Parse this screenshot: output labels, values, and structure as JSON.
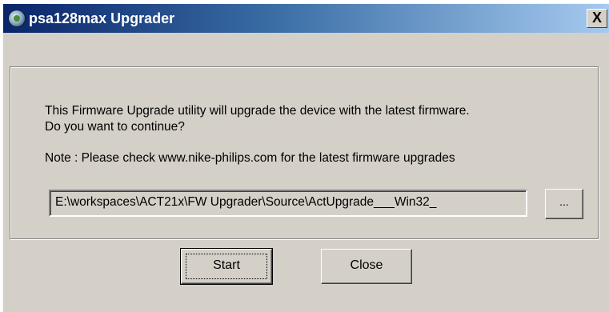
{
  "window": {
    "title": "psa128max Upgrader",
    "close_glyph": "X"
  },
  "dialog": {
    "message_line1": "This Firmware Upgrade utility will upgrade the device with the latest firmware.",
    "message_line2": "Do you want to continue?",
    "note": "Note : Please check www.nike-philips.com for the latest firmware upgrades",
    "path_value": "E:\\workspaces\\ACT21x\\FW Upgrader\\Source\\ActUpgrade___Win32_",
    "browse_label": "...",
    "start_label": "Start",
    "close_label": "Close"
  }
}
